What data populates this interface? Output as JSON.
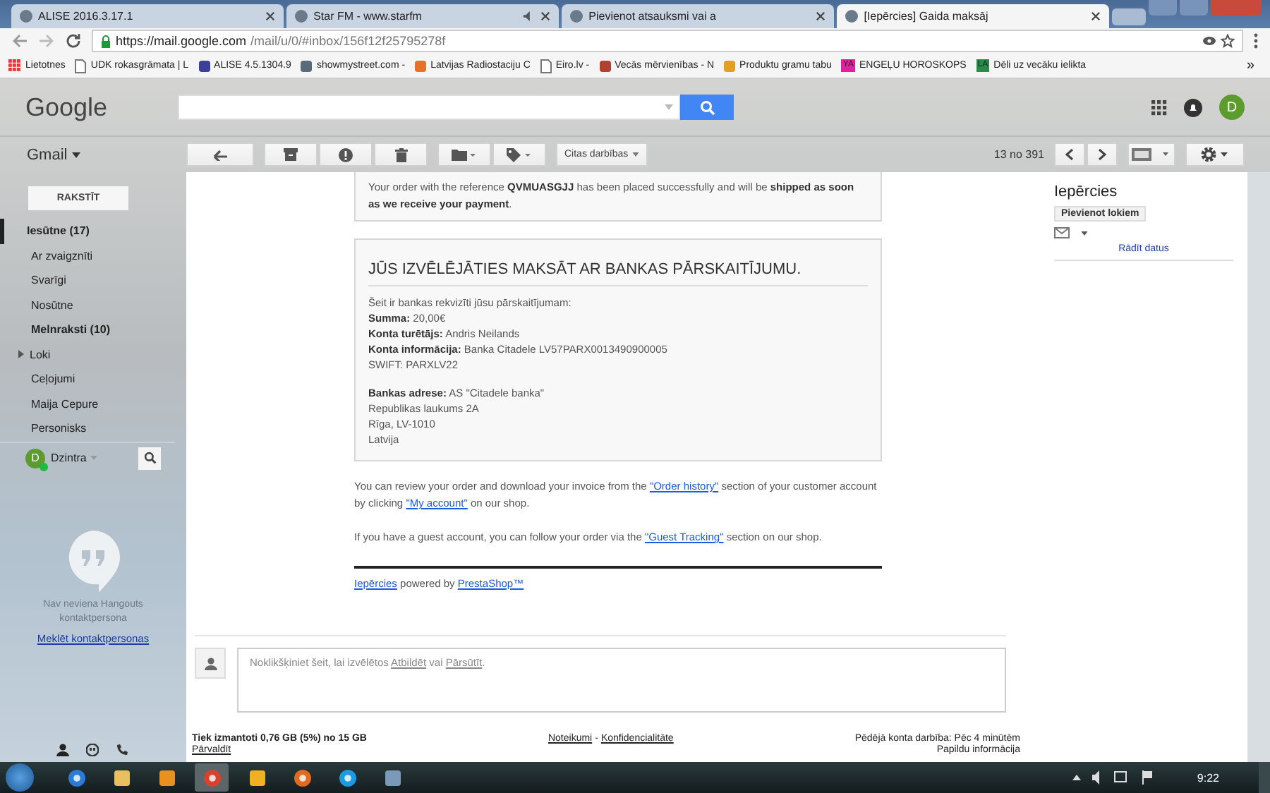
{
  "browser": {
    "tabs": [
      {
        "title": "ALISE 2016.3.17.1",
        "selected": false,
        "muted": false
      },
      {
        "title": "Star FM - www.starfm",
        "selected": false,
        "muted": true
      },
      {
        "title": "Pievienot atsauksmi vai a",
        "selected": false,
        "muted": false
      },
      {
        "title": "[Iepērcies] Gaida maksāj",
        "selected": true,
        "muted": false
      }
    ],
    "url_host": "https://mail.google.com",
    "url_path": "/mail/u/0/#inbox/156f12f25795278f",
    "bookmarks": [
      {
        "label": "Lietotnes",
        "kind": "apps"
      },
      {
        "label": "UDK rokasgrāmata | L",
        "kind": "page"
      },
      {
        "label": "ALISE 4.5.1304.9",
        "kind": "site",
        "color": "#3b3f9a"
      },
      {
        "label": "showmystreet.com - ",
        "kind": "site",
        "color": "#5a6a7a"
      },
      {
        "label": "Latvijas Radiostaciju C",
        "kind": "site",
        "color": "#e8702a"
      },
      {
        "label": "Eiro.lv - ",
        "kind": "page"
      },
      {
        "label": "Vecās mērvienības - N",
        "kind": "site",
        "color": "#b04030"
      },
      {
        "label": "Produktu gramu tabu",
        "kind": "site",
        "color": "#e0a020"
      },
      {
        "label": "ENGEĻU HOROSKOPS",
        "kind": "badge",
        "badge": "YA",
        "color": "#e020a0"
      },
      {
        "label": "Dēli uz vecāku ielikta",
        "kind": "badge",
        "badge": "LA",
        "color": "#2a8a4a"
      }
    ],
    "bookmarks_more": "»"
  },
  "header": {
    "logo": "Google",
    "avatar": "D",
    "app": "Gmail"
  },
  "toolbar": {
    "more_actions": "Citas darbības",
    "page_info": "13 no 391"
  },
  "sidebar": {
    "compose": "RAKSTĪT",
    "folders": [
      {
        "label": "Iesūtne (17)",
        "unread": true,
        "selected": true,
        "expandable": false
      },
      {
        "label": "Ar zvaigznīti",
        "unread": false,
        "selected": false,
        "expandable": false
      },
      {
        "label": "Svarīgi",
        "unread": false,
        "selected": false,
        "expandable": false
      },
      {
        "label": "Nosūtne",
        "unread": false,
        "selected": false,
        "expandable": false
      },
      {
        "label": "Melnraksti (10)",
        "unread": true,
        "selected": false,
        "expandable": false
      },
      {
        "label": "Loki",
        "unread": false,
        "selected": false,
        "expandable": true
      },
      {
        "label": "Ceļojumi",
        "unread": false,
        "selected": false,
        "expandable": false
      },
      {
        "label": "Maija Cepure",
        "unread": false,
        "selected": false,
        "expandable": false
      },
      {
        "label": "Personisks",
        "unread": false,
        "selected": false,
        "expandable": false
      }
    ],
    "user": {
      "initial": "D",
      "name": "Dzintra",
      "online": true
    },
    "hangouts": {
      "empty_text": "Nav neviena Hangouts kontaktpersona",
      "link": "Meklēt kontaktpersonas"
    }
  },
  "email": {
    "intro": "Your order with the reference **QVMUASGJJ** has been placed successfully and will be **shipped as soon as we receive your payment**.",
    "bank": {
      "heading": "JŪS IZVĒLĒJĀTIES MAKSĀT AR BANKAS PĀRSKAITĪJUMU.",
      "lines": [
        "Šeit ir bankas rekvizīti jūsu pārskaitījumam:",
        "**Summa:** 20,00€",
        "**Konta turētājs:** Andris Neilands",
        "**Konta informācija:** Banka Citadele LV57PARX0013490900005",
        "SWIFT: PARXLV22"
      ],
      "address": [
        "**Bankas adrese:** AS \"Citadele banka\"",
        "Republikas laukums 2A",
        "Rīga, LV-1010",
        "Latvija"
      ]
    },
    "paragraphs": [
      [
        {
          "kind": "text",
          "text": "You can review your order and download your invoice from the "
        },
        {
          "kind": "link",
          "text": "\"Order history\""
        },
        {
          "kind": "text",
          "text": " section of your customer account by clicking "
        },
        {
          "kind": "link",
          "text": "\"My account\""
        },
        {
          "kind": "text",
          "text": " on our shop."
        }
      ],
      [
        {
          "kind": "text",
          "text": "If you have a guest account, you can follow your order via the "
        },
        {
          "kind": "link",
          "text": "\"Guest Tracking\""
        },
        {
          "kind": "text",
          "text": " section on our shop."
        }
      ]
    ],
    "footer": [
      {
        "kind": "link",
        "text": "Iepērcies"
      },
      {
        "kind": "text",
        "text": " powered by "
      },
      {
        "kind": "link",
        "text": "PrestaShop™"
      }
    ]
  },
  "reply": [
    {
      "kind": "text",
      "text": "Noklikšķiniet šeit, lai izvēlētos "
    },
    {
      "kind": "link",
      "text": "Atbildēt"
    },
    {
      "kind": "text",
      "text": " vai "
    },
    {
      "kind": "link",
      "text": "Pārsūtīt"
    },
    {
      "kind": "text",
      "text": "."
    }
  ],
  "sender_pane": {
    "name": "Iepērcies",
    "add_button": "Pievienot lokiem",
    "details_link": "Rādīt datus"
  },
  "footer": {
    "storage": "Tiek izmantoti 0,76 GB (5%) no 15 GB",
    "manage": "Pārvaldīt",
    "terms": "Noteikumi",
    "separator": "-",
    "privacy": "Konfidencialitāte",
    "activity": "Pēdējā konta darbība: Pēc 4 minūtēm",
    "details": "Papildu informācija"
  },
  "taskbar": {
    "time": "9:22",
    "apps": [
      {
        "kind": "ie",
        "selected": false
      },
      {
        "kind": "folder",
        "selected": false
      },
      {
        "kind": "media",
        "selected": false
      },
      {
        "kind": "chrome",
        "selected": true
      },
      {
        "kind": "notes",
        "selected": false
      },
      {
        "kind": "firefox",
        "selected": false
      },
      {
        "kind": "skype",
        "selected": false
      },
      {
        "kind": "paint",
        "selected": false
      }
    ]
  }
}
